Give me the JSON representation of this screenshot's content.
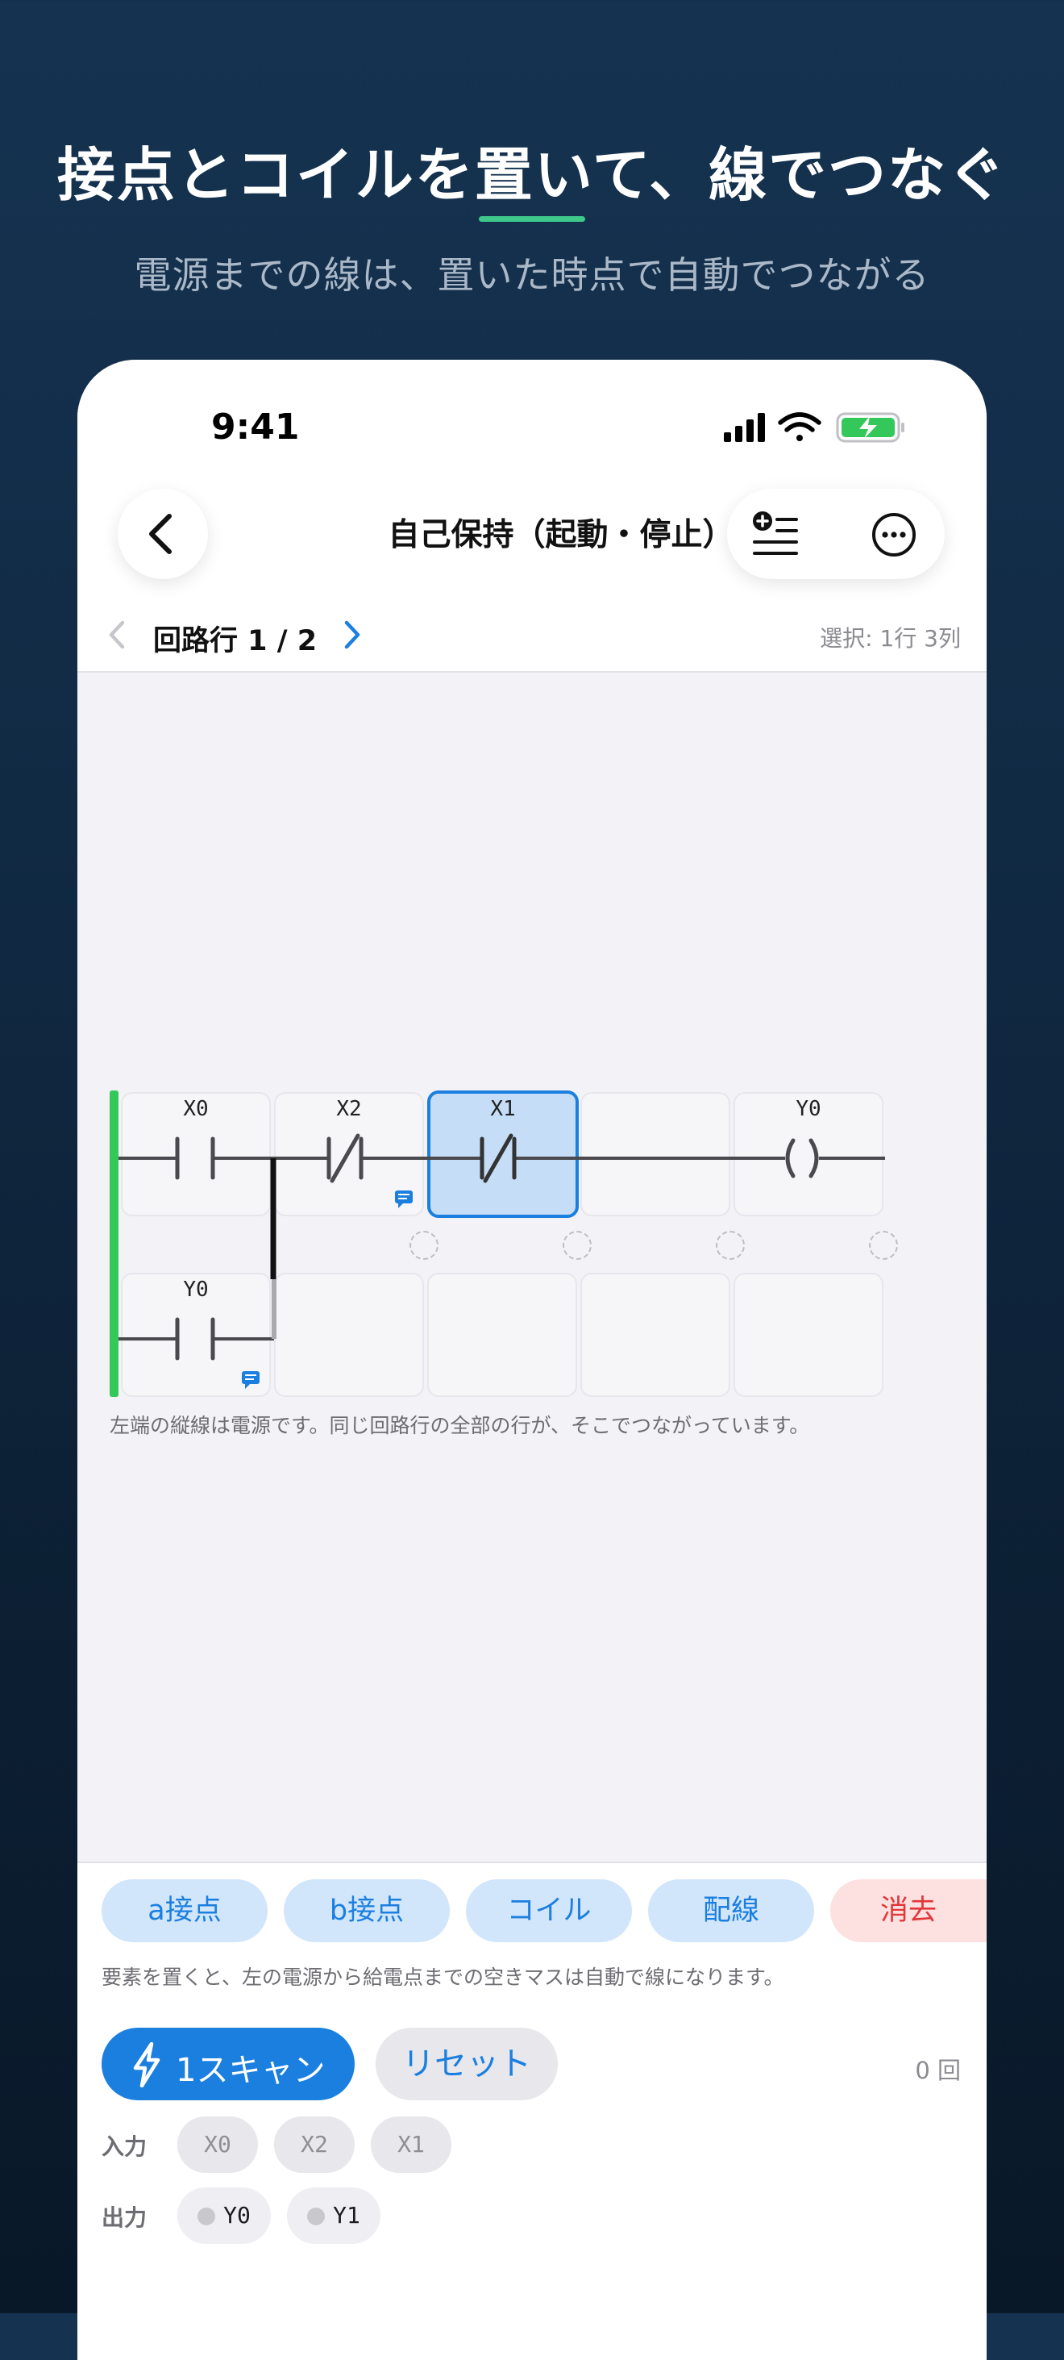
{
  "promo": {
    "title": "接点とコイルを置いて、線でつなぐ",
    "subtitle": "電源までの線は、置いた時点で自動でつながる"
  },
  "status_bar": {
    "time": "9:41"
  },
  "nav": {
    "title": "自己保持（起動・停止）"
  },
  "circuit_nav": {
    "label": "回路行 1 / 2",
    "selection_info": "選択: 1行 3列"
  },
  "ladder": {
    "row1": [
      {
        "label": "X0",
        "element": "a-contact"
      },
      {
        "label": "X2",
        "element": "b-contact",
        "has_comment": true
      },
      {
        "label": "X1",
        "element": "b-contact",
        "selected": true
      },
      {
        "label": "",
        "element": "wire"
      },
      {
        "label": "Y0",
        "element": "coil"
      }
    ],
    "row2": [
      {
        "label": "Y0",
        "element": "a-contact",
        "has_comment": true
      },
      {
        "label": "",
        "element": "empty"
      },
      {
        "label": "",
        "element": "empty"
      },
      {
        "label": "",
        "element": "empty"
      },
      {
        "label": "",
        "element": "empty"
      }
    ],
    "note": "左端の縦線は電源です。同じ回路行の全部の行が、そこでつながっています。"
  },
  "palette": {
    "tools": [
      "a接点",
      "b接点",
      "コイル",
      "配線",
      "消去"
    ],
    "note": "要素を置くと、左の電源から給電点までの空きマスは自動で線になります。"
  },
  "simulation": {
    "scan_label": "1スキャン",
    "reset_label": "リセット",
    "scan_count": "0 回",
    "input_label": "入力",
    "inputs": [
      "X0",
      "X2",
      "X1"
    ],
    "output_label": "出力",
    "outputs": [
      "Y0",
      "Y1"
    ]
  },
  "colors": {
    "accent": "#1b7fe0",
    "power_rail": "#34c759",
    "promo_underline": "#3ec98a",
    "danger": "#e0383a"
  }
}
